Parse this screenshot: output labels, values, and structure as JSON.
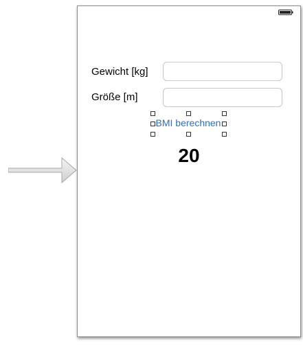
{
  "form": {
    "weight_label": "Gewicht [kg]",
    "weight_value": "",
    "height_label": "Größe [m]",
    "height_value": ""
  },
  "button": {
    "label": "BMI berechnen",
    "color": "#2a6fc9"
  },
  "result": {
    "value": "20"
  },
  "status_bar": {
    "icon": "battery-icon"
  },
  "entry_arrow": {
    "icon": "entry-arrow-icon"
  }
}
